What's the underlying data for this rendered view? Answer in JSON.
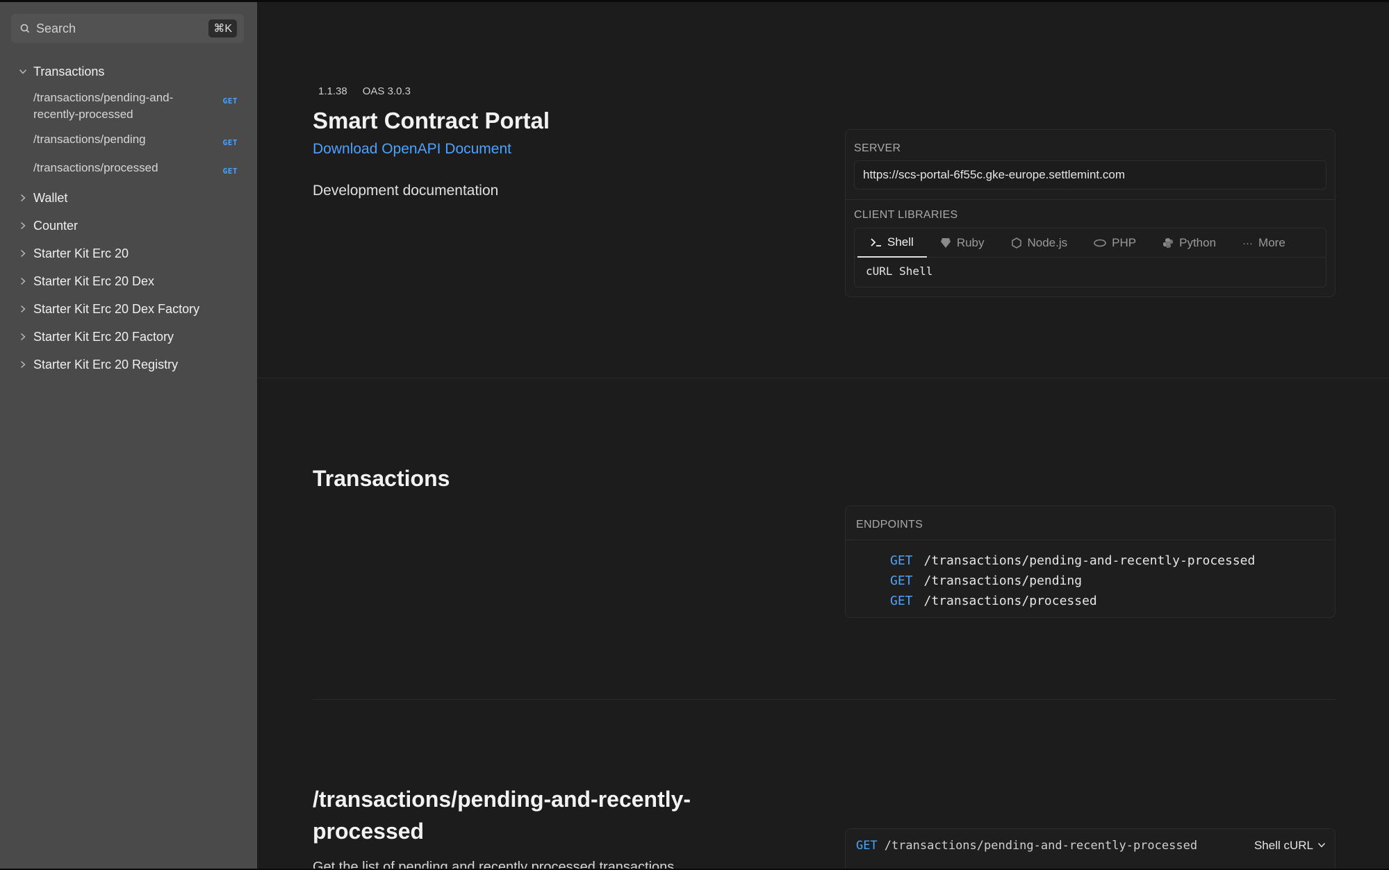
{
  "search": {
    "placeholder": "Search",
    "shortcut": "⌘K"
  },
  "sidebar": {
    "groups": [
      {
        "label": "Transactions",
        "expanded": true,
        "items": [
          {
            "path_line1": "/transactions/pending-and-",
            "path_line2": "recently-processed",
            "method": "GET"
          },
          {
            "path_line1": "/transactions/pending",
            "method": "GET"
          },
          {
            "path_line1": "/transactions/processed",
            "method": "GET"
          }
        ]
      },
      {
        "label": "Wallet"
      },
      {
        "label": "Counter"
      },
      {
        "label": "Starter Kit Erc 20"
      },
      {
        "label": "Starter Kit Erc 20 Dex"
      },
      {
        "label": "Starter Kit Erc 20 Dex Factory"
      },
      {
        "label": "Starter Kit Erc 20 Factory"
      },
      {
        "label": "Starter Kit Erc 20 Registry"
      }
    ]
  },
  "info": {
    "version": "1.1.38",
    "oas": "OAS 3.0.3",
    "title": "Smart Contract Portal",
    "download_label": "Download OpenAPI Document",
    "description": "Development documentation"
  },
  "server": {
    "label": "SERVER",
    "url": "https://scs-portal-6f55c.gke-europe.settlemint.com"
  },
  "client_libraries": {
    "label": "CLIENT LIBRARIES",
    "tabs": [
      "Shell",
      "Ruby",
      "Node.js",
      "PHP",
      "Python",
      "More"
    ],
    "active": "Shell",
    "code": "cURL Shell"
  },
  "transactions_section": {
    "title": "Transactions",
    "endpoints_label": "ENDPOINTS",
    "endpoints": [
      {
        "method": "GET",
        "path": "/transactions/pending-and-recently-processed"
      },
      {
        "method": "GET",
        "path": "/transactions/pending"
      },
      {
        "method": "GET",
        "path": "/transactions/processed"
      }
    ]
  },
  "operation": {
    "title": "/transactions/pending-and-recently-processed",
    "description": "Get the list of pending and recently processed transactions",
    "method": "GET",
    "path": "/transactions/pending-and-recently-processed",
    "language": "Shell cURL"
  },
  "colors": {
    "accent": "#4aa3ff",
    "sidebar_bg": "#4a4a4a",
    "main_bg": "#1c1c1c"
  }
}
